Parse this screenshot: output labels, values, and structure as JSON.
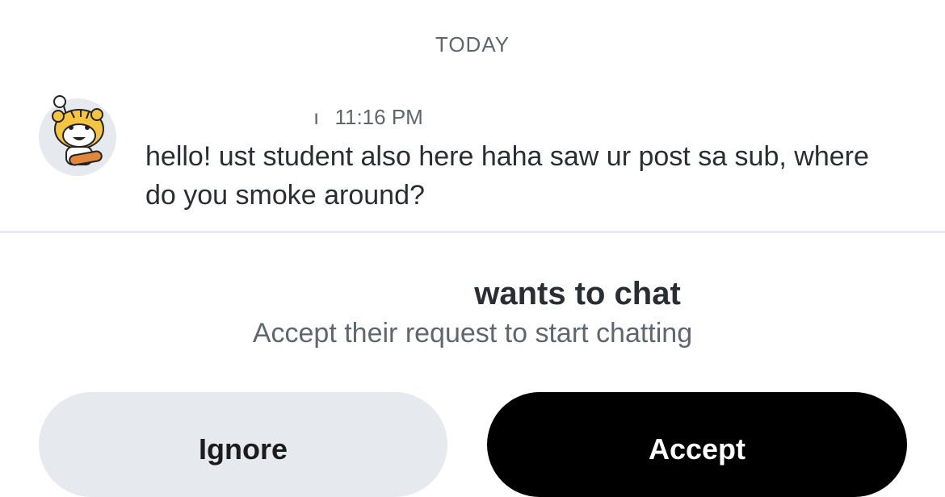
{
  "date_divider": "TODAY",
  "message": {
    "sender_mark": "ı",
    "time": "11:16 PM",
    "text": "hello! ust student also here haha saw ur post sa sub, where do you smoke around?"
  },
  "request": {
    "title": "wants to chat",
    "subtitle": "Accept their request to start chatting"
  },
  "buttons": {
    "ignore_label": "Ignore",
    "accept_label": "Accept"
  },
  "colors": {
    "accent_button": "#000000",
    "secondary_button": "#e6e9ed",
    "muted_text": "#5f6670",
    "avatar_fur": "#f5c542"
  },
  "icons": {
    "avatar": "snoo-tiger-avatar-icon"
  }
}
